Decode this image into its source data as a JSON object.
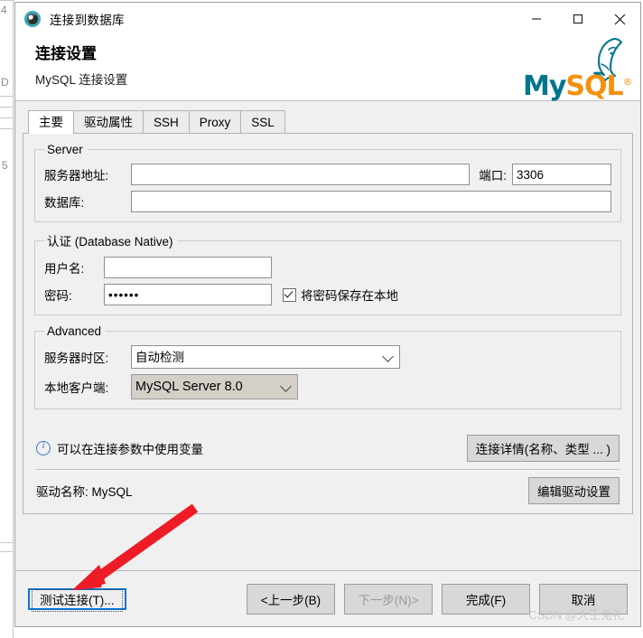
{
  "window": {
    "title": "连接到数据库",
    "icon": "dbeaver-beaver-icon",
    "controls": {
      "minimize": "minimize-icon",
      "maximize": "maximize-icon",
      "close": "close-icon"
    }
  },
  "header": {
    "title": "连接设置",
    "subtitle": "MySQL 连接设置",
    "logo": {
      "word_my": "My",
      "word_sql": "SQL",
      "registered": "®",
      "teal": "#00758F",
      "orange": "#F29111"
    }
  },
  "tabs": [
    {
      "label": "主要",
      "active": true
    },
    {
      "label": "驱动属性",
      "active": false
    },
    {
      "label": "SSH",
      "active": false
    },
    {
      "label": "Proxy",
      "active": false
    },
    {
      "label": "SSL",
      "active": false
    }
  ],
  "server_group": {
    "legend": "Server",
    "host_label": "服务器地址:",
    "host_value": "",
    "host_redacted": true,
    "port_label": "端口:",
    "port_value": "3306",
    "database_label": "数据库:",
    "database_value": ""
  },
  "auth_group": {
    "legend": "认证 (Database Native)",
    "username_label": "用户名:",
    "username_value": "",
    "username_redacted": true,
    "password_label": "密码:",
    "password_value": "••••••",
    "save_password_label": "将密码保存在本地",
    "save_password_checked": true
  },
  "advanced_group": {
    "legend": "Advanced",
    "timezone_label": "服务器时区:",
    "timezone_value": "自动检测",
    "client_label": "本地客户端:",
    "client_value": "MySQL Server 8.0"
  },
  "info_row": {
    "icon": "info-circle-icon",
    "text": "可以在连接参数中使用变量",
    "details_button": "连接详情(名称、类型 ... )"
  },
  "driver_row": {
    "text": "驱动名称: MySQL",
    "edit_button": "编辑驱动设置"
  },
  "bottom_bar": {
    "test_connection": "测试连接(T)...",
    "back": "<上一步(B)",
    "next": "下一步(N)>",
    "next_disabled": true,
    "finish": "完成(F)",
    "cancel": "取消"
  },
  "watermark": "CSDN @大王兔礼",
  "annotation": {
    "type": "red-arrow",
    "color": "#ED1C24",
    "points_to": "测试连接(T)..."
  },
  "background_window": {
    "fragments": [
      "4",
      "D",
      "5"
    ]
  }
}
